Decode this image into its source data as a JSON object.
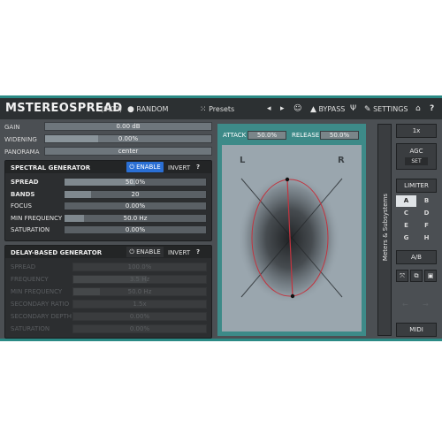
{
  "plugin": {
    "name": "MSTEREOSPREAD",
    "version": "(9.00)",
    "random_label": "RANDOM",
    "presets_label": "Presets",
    "bypass_label": "BYPASS",
    "settings_label": "SETTINGS",
    "help_label": "?"
  },
  "global": {
    "gain_label": "GAIN",
    "gain_value": "0.00 dB",
    "widening_label": "WIDENING",
    "widening_value": "0.00%",
    "widening_fill": 0.32,
    "panorama_label": "PANORAMA",
    "panorama_value": "center"
  },
  "spectral": {
    "title": "SPECTRAL GENERATOR",
    "enable_label": "ENABLE",
    "invert_label": "INVERT",
    "help_label": "?",
    "params": [
      {
        "label": "SPREAD",
        "value": "50.0%",
        "fill": 0.5
      },
      {
        "label": "BANDS",
        "value": "20",
        "fill": 0.19
      },
      {
        "label": "FOCUS",
        "value": "0.00%",
        "fill": 0.0
      },
      {
        "label": "MIN FREQUENCY",
        "value": "50.0 Hz",
        "fill": 0.14
      },
      {
        "label": "SATURATION",
        "value": "0.00%",
        "fill": 0.0
      }
    ]
  },
  "delay": {
    "title": "DELAY-BASED GENERATOR",
    "enable_label": "ENABLE",
    "invert_label": "INVERT",
    "help_label": "?",
    "params": [
      {
        "label": "SPREAD",
        "value": "100.0%"
      },
      {
        "label": "FREQUENCY",
        "value": "3.5 Hz"
      },
      {
        "label": "MIN FREQUENCY",
        "value": "50.0 Hz"
      },
      {
        "label": "SECONDARY RATIO",
        "value": "1.5x"
      },
      {
        "label": "SECONDARY DEPTH",
        "value": "0.00%"
      },
      {
        "label": "SATURATION",
        "value": "0.00%"
      }
    ]
  },
  "scope": {
    "attack_label": "ATTACK",
    "attack_value": "50.0%",
    "release_label": "RELEASE",
    "release_value": "50.0%",
    "left_label": "L",
    "right_label": "R"
  },
  "side_tab": {
    "label": "Meters & Subsystems"
  },
  "right_panel": {
    "zoom_label": "1x",
    "agc_label": "AGC",
    "set_label": "SET",
    "limiter_label": "LIMITER",
    "ab_slots": [
      "A",
      "B",
      "C",
      "D",
      "E",
      "F",
      "G",
      "H"
    ],
    "ab_label": "A/B",
    "midi_label": "MIDI"
  }
}
